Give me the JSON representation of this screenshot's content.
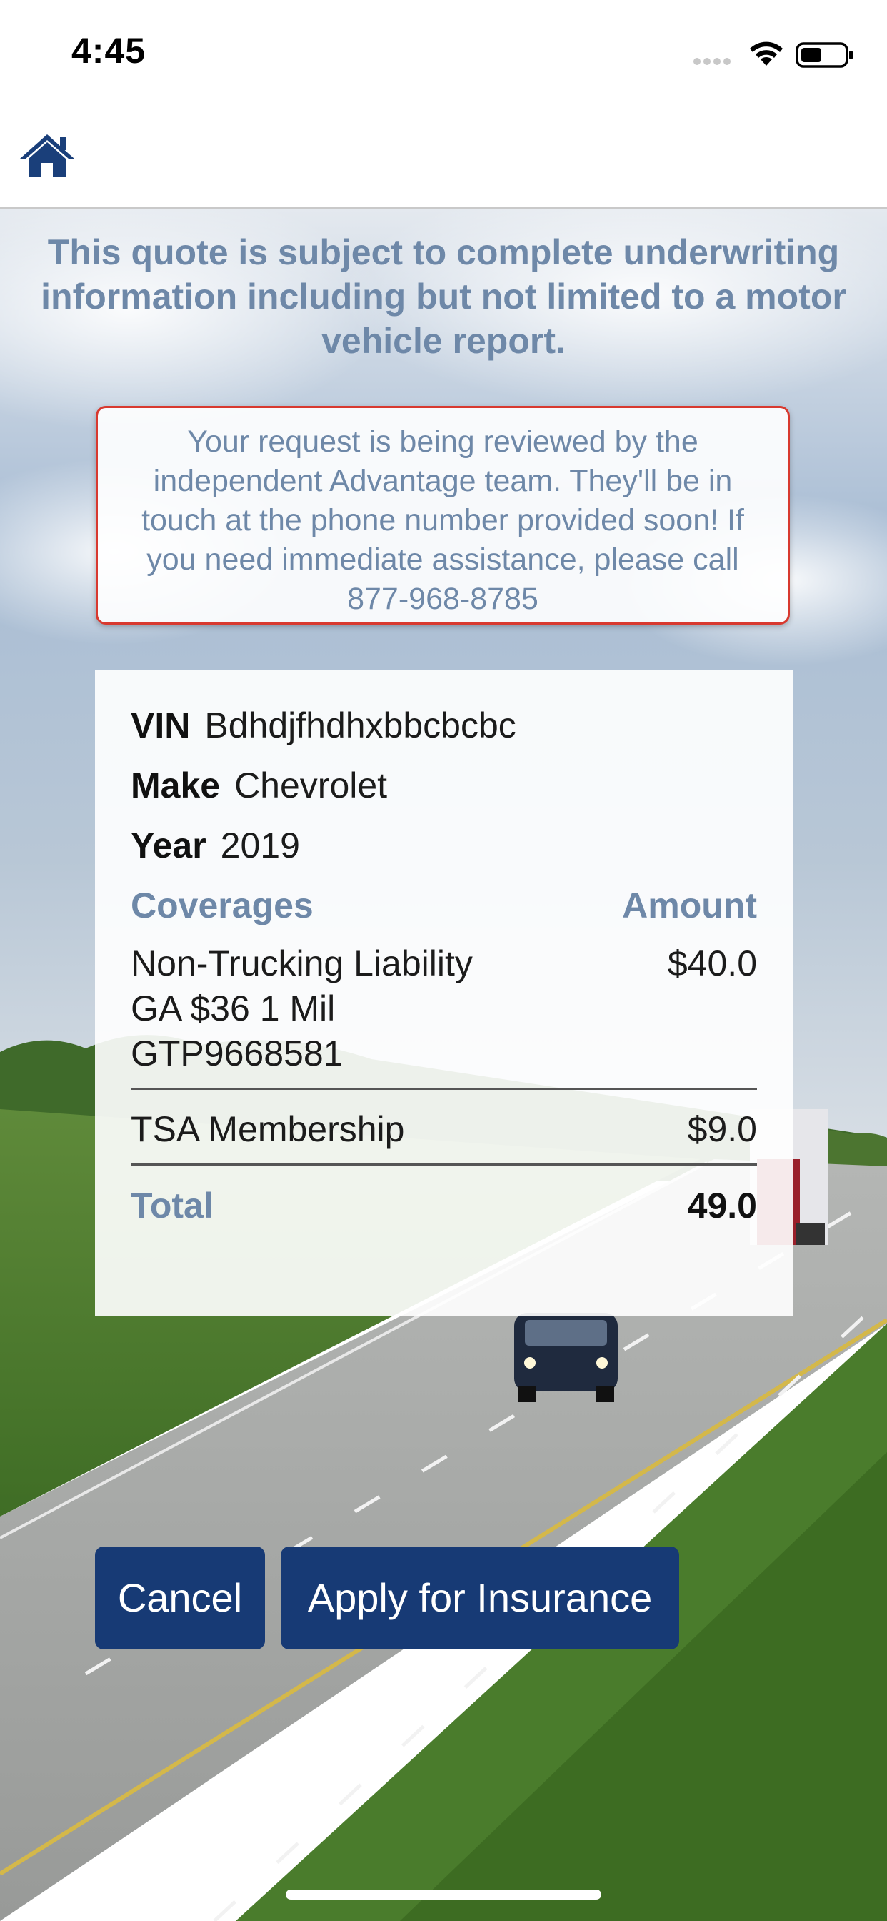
{
  "status_bar": {
    "time": "4:45"
  },
  "nav": {
    "home_icon": "home-icon"
  },
  "disclaimer": "This quote is subject to complete underwriting information including but not limited to a motor vehicle report.",
  "notice": "Your request is being reviewed by the independent Advantage team. They'll be in touch at the phone number provided soon! If you need immediate assistance, please call 877-968-8785",
  "vehicle": {
    "vin_label": "VIN",
    "vin_value": "Bdhdjfhdhxbbcbcbc",
    "make_label": "Make",
    "make_value": "Chevrolet",
    "year_label": "Year",
    "year_value": "2019"
  },
  "coverages": {
    "header_name": "Coverages",
    "header_amount": "Amount",
    "items": [
      {
        "name": "Non-Trucking Liability\nGA $36 1 Mil\nGTP9668581",
        "amount": "$40.0"
      },
      {
        "name": "TSA Membership",
        "amount": "$9.0"
      }
    ],
    "total_label": "Total",
    "total_value": "49.0"
  },
  "buttons": {
    "cancel": "Cancel",
    "apply": "Apply for Insurance"
  },
  "colors": {
    "brand_navy": "#173a75",
    "label_blue": "#6e88a8",
    "alert_red": "#d8392f"
  }
}
